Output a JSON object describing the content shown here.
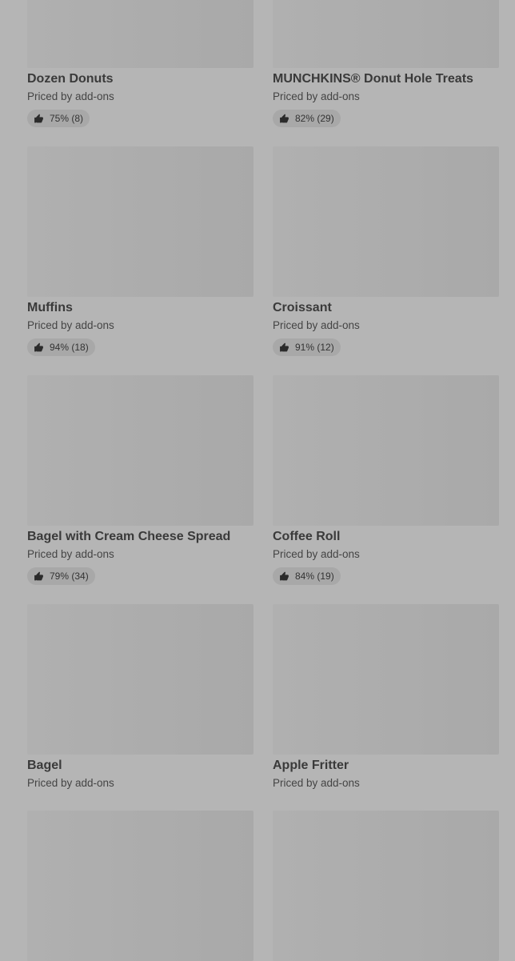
{
  "items": [
    {
      "title": "Dozen Donuts",
      "price": "Priced by add-ons",
      "rating": "75% (8)"
    },
    {
      "title": "MUNCHKINS® Donut Hole Treats",
      "price": "Priced by add-ons",
      "rating": "82% (29)"
    },
    {
      "title": "Muffins",
      "price": "Priced by add-ons",
      "rating": "94% (18)"
    },
    {
      "title": "Croissant",
      "price": "Priced by add-ons",
      "rating": "91% (12)"
    },
    {
      "title": "Bagel with Cream Cheese Spread",
      "price": "Priced by add-ons",
      "rating": "79% (34)"
    },
    {
      "title": "Coffee Roll",
      "price": "Priced by add-ons",
      "rating": "84% (19)"
    },
    {
      "title": "Bagel",
      "price": "Priced by add-ons"
    },
    {
      "title": "Apple Fritter",
      "price": "Priced by add-ons"
    }
  ],
  "icons": {
    "rating": "thumbs-up-icon"
  }
}
